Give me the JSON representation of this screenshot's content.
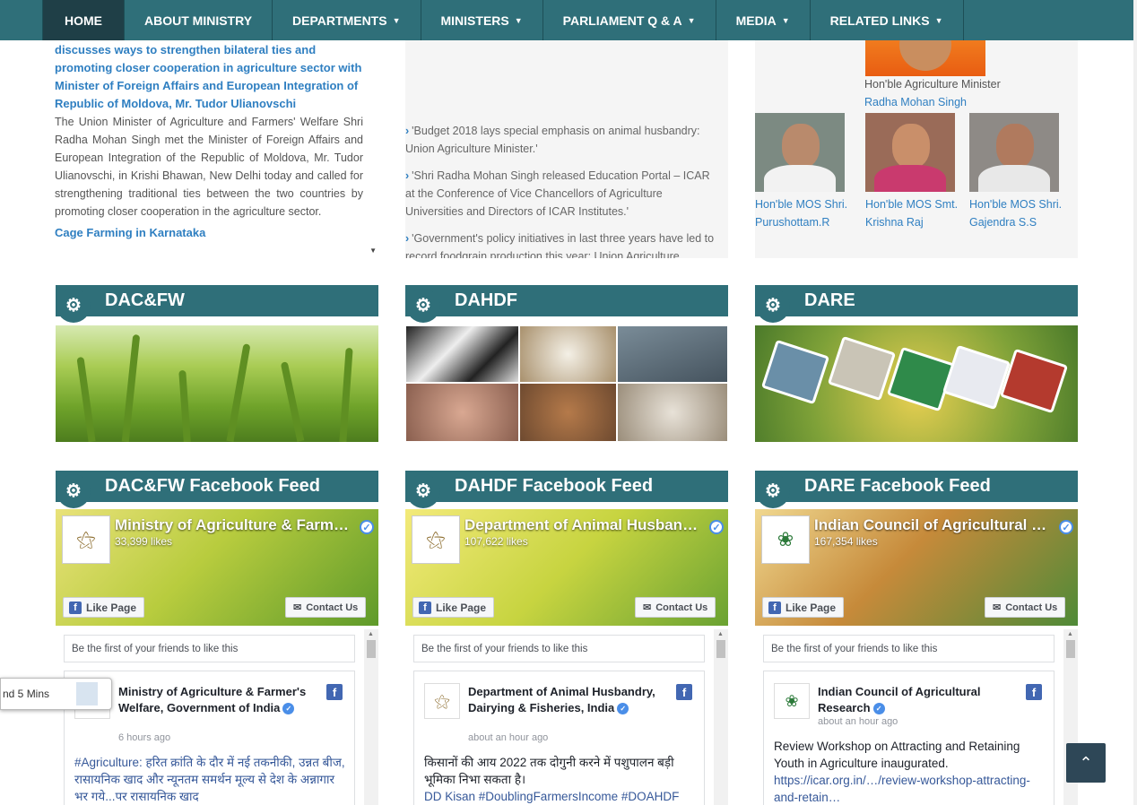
{
  "nav": {
    "items": [
      {
        "label": "HOME"
      },
      {
        "label": "ABOUT MINISTRY"
      },
      {
        "label": "DEPARTMENTS"
      },
      {
        "label": "MINISTERS"
      },
      {
        "label": "PARLIAMENT Q & A"
      },
      {
        "label": "MEDIA"
      },
      {
        "label": "RELATED LINKS"
      }
    ]
  },
  "news": {
    "title": "discusses ways to strengthen bilateral ties and promoting closer cooperation in agriculture sector with Minister of Foreign Affairs and European Integration of Republic of Moldova, Mr. Tudor Ulianovschi",
    "body": "The Union Minister of Agriculture and Farmers' Welfare Shri Radha Mohan Singh met the Minister of Foreign Affairs and European Integration of the Republic of Moldova, Mr. Tudor Ulianovschi, in Krishi Bhawan, New Delhi today and called for strengthening traditional ties between the two countries by promoting closer cooperation in the agriculture sector.",
    "next_title": "Cage Farming in Karnataka"
  },
  "speeches": [
    {
      "text": "'Budget 2018 lays special emphasis on animal husbandry: Union Agriculture Minister.'"
    },
    {
      "text": "'Shri Radha Mohan Singh released Education Portal – ICAR at the Conference of Vice Chancellors of Agriculture Universities and Directors of ICAR Institutes.'"
    },
    {
      "text": "'Government's policy initiatives in last three years have led to record foodgrain production this year: Union Agriculture"
    }
  ],
  "ministers": {
    "caption": "Hon'ble Agriculture Minister",
    "name": "Radha Mohan Singh",
    "mos": [
      {
        "line1": "Hon'ble MOS Shri.",
        "line2": "Purushottam.R"
      },
      {
        "line1": "Hon'ble MOS Smt.",
        "line2": "Krishna Raj"
      },
      {
        "line1": "Hon'ble MOS Shri.",
        "line2": "Gajendra S.S"
      }
    ]
  },
  "sections": [
    {
      "title": "DAC&FW"
    },
    {
      "title": "DAHDF"
    },
    {
      "title": "DARE"
    }
  ],
  "feeds": [
    {
      "title": "DAC&FW Facebook Feed",
      "page_name": "Ministry of Agriculture & Farmers Welfare, Government of India",
      "likes": "33,399 likes",
      "like_label": "Like Page",
      "contact_label": "Contact Us",
      "friends_text": "Be the first of your friends to like this",
      "author": "Ministry of Agriculture & Farmer's Welfare, Government of India",
      "time": "6 hours ago",
      "post_text": "#Agriculture: हरित क्रांति के दौर में नई तकनीकी, उन्नत बीज, रासायनिक खाद और न्यूनतम समर्थन मूल्य से देश के अन्नागार भर गये...पर रासायनिक खाद",
      "post_link": ""
    },
    {
      "title": "DAHDF Facebook Feed",
      "page_name": "Department of Animal Husbandry, Dairying & Fisheries, India",
      "likes": "107,622 likes",
      "like_label": "Like Page",
      "contact_label": "Contact Us",
      "friends_text": "Be the first of your friends to like this",
      "author": "Department of Animal Husbandry, Dairying & Fisheries, India",
      "time": "about an hour ago",
      "post_text": "किसानों की आय 2022 तक दोगुनी करने में पशुपालन बड़ी भूमिका निभा सकता है।",
      "post_link": "DD Kisan #DoublingFarmersIncome #DOAHDF"
    },
    {
      "title": "DARE Facebook Feed",
      "page_name": "Indian Council of Agricultural Research",
      "likes": "167,354 likes",
      "like_label": "Like Page",
      "contact_label": "Contact Us",
      "friends_text": "Be the first of your friends to like this",
      "author": "Indian Council of Agricultural Research",
      "time": "about an hour ago",
      "post_text": "Review Workshop on Attracting and Retaining Youth in Agriculture inaugurated.",
      "post_link": "https://icar.org.in/…/review-workshop-attracting-and-retain…"
    }
  ],
  "float_tab": {
    "label": "nd 5 Mins"
  },
  "totop": {
    "icon": "chevron-up-icon"
  },
  "colors": {
    "teal": "#2f6f79",
    "link": "#2f7fc1",
    "fb_blue": "#4267b2"
  }
}
